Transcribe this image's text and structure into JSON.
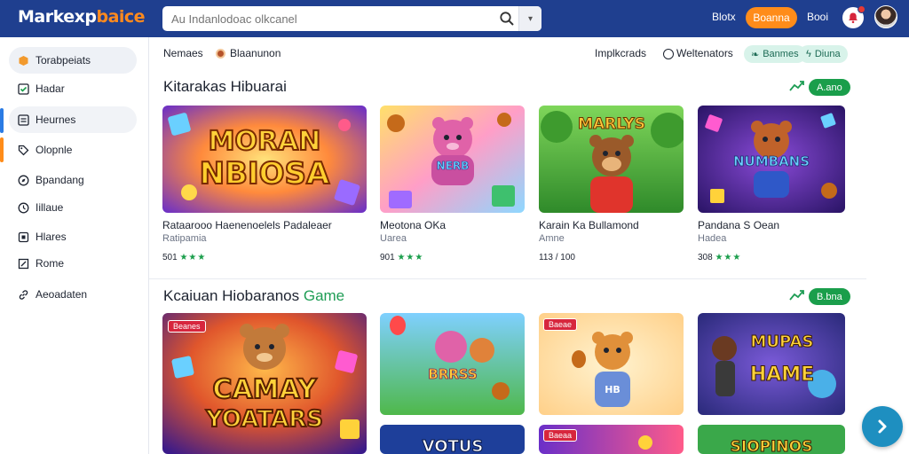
{
  "header": {
    "logo_main": "Markexp",
    "logo_accent": "baice",
    "search_placeholder": "Au Indanlodoac olkcanel",
    "link_1": "Blotx",
    "orange_button": "Boanna",
    "link_2": "Booi",
    "colors": {
      "bar": "#1f3f8f",
      "accent": "#ff8c1a"
    }
  },
  "sidebar": {
    "items": [
      {
        "label": "Torabpeiats",
        "icon": "box-icon"
      },
      {
        "label": "Hadar",
        "icon": "check-square-icon"
      },
      {
        "label": "Heurnes",
        "icon": "list-icon"
      },
      {
        "label": "Olopnle",
        "icon": "tag-icon"
      },
      {
        "label": "Bpandang",
        "icon": "compass-icon"
      },
      {
        "label": "Iillaue",
        "icon": "clock-icon"
      },
      {
        "label": "Hlares",
        "icon": "square-icon"
      },
      {
        "label": "Rome",
        "icon": "edit-icon"
      },
      {
        "label": "Aeoadaten",
        "icon": "link-icon"
      }
    ]
  },
  "filters": {
    "left_1": "Nemaes",
    "left_2": "Blaanunon",
    "right_1": "Implkcrads",
    "right_2": "Weltenators",
    "pill_1": "Banmes",
    "pill_2": "Diuna"
  },
  "section1": {
    "title": "Kitarakas Hibuarai",
    "trend_icon": "trend-up-icon",
    "badge": "A.ano",
    "cards": [
      {
        "art_text": [
          "MORAN",
          "NBIOSA"
        ],
        "title": "Rataarooo Haenenoelels Padaleaer",
        "sub": "Ratipamia",
        "rating": "501",
        "stars": "★★★"
      },
      {
        "art_text": [
          "NERB"
        ],
        "title": "Meotona OKa",
        "sub": "Uarea",
        "rating": "901",
        "stars": "★★★"
      },
      {
        "art_text": [
          "MARLYS"
        ],
        "title": "Karain Ka Bullamond",
        "sub": "Amne",
        "rating": "113 / 100",
        "stars": ""
      },
      {
        "art_text": [
          "NUMBANS"
        ],
        "title": "Pandana S Oean",
        "sub": "Hadea",
        "rating": "308",
        "stars": "★★★"
      }
    ]
  },
  "section2": {
    "title": "Kcaiuan Hiobaranos",
    "title_accent": "Game",
    "trend_icon": "trend-up-icon",
    "badge": "B.bna",
    "cards": [
      {
        "art_text": [
          "CAMAY",
          "YOATARS"
        ],
        "tag": "Beanes"
      },
      {
        "art_text": [
          "BRRSS"
        ],
        "tag": ""
      },
      {
        "art_text": [
          "HB"
        ],
        "tag": "Baeae"
      },
      {
        "art_text": [
          "MUPAS",
          "HAME"
        ],
        "tag": ""
      },
      {
        "art_text": [
          "VOTUS"
        ],
        "tag": ""
      },
      {
        "art_text": [],
        "tag": "Baeaa"
      },
      {
        "art_text": [
          "SIOPINOS"
        ],
        "tag": ""
      }
    ]
  }
}
